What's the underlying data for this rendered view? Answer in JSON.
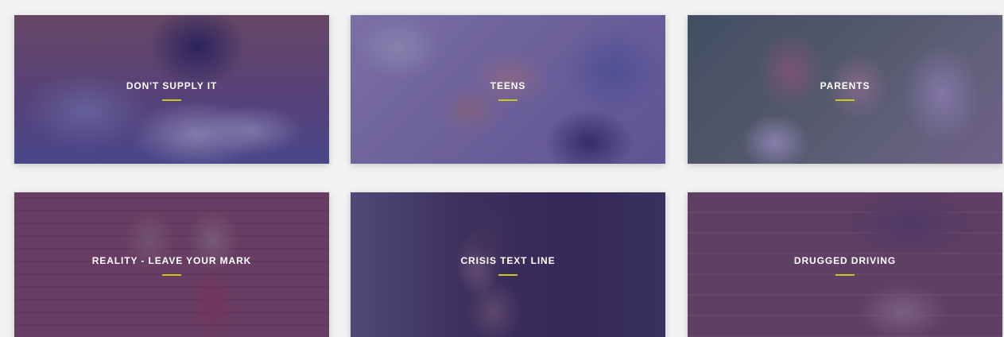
{
  "colors": {
    "page_background": "#f2f2f3",
    "overlay": "#3b2a78",
    "underline_accent": "#c8c81e",
    "title_text": "#ffffff"
  },
  "cards": [
    {
      "title": "DON'T SUPPLY IT",
      "image": "shoes-splashing-water"
    },
    {
      "title": "TEENS",
      "image": "teens-stacking-hands"
    },
    {
      "title": "PARENTS",
      "image": "parents-with-child"
    },
    {
      "title": "REALITY - LEAVE YOUR MARK",
      "image": "teens-holding-prevention-frame"
    },
    {
      "title": "CRISIS TEXT LINE",
      "image": "teen-looking-at-phone"
    },
    {
      "title": "DRUGGED DRIVING",
      "image": "hand-on-steering"
    }
  ]
}
